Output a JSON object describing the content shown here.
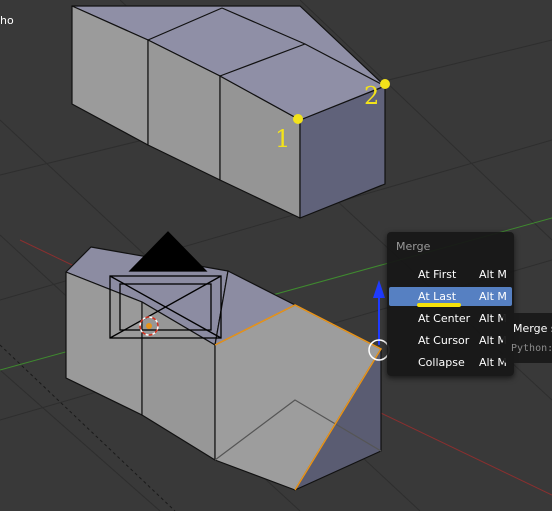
{
  "viewport": {
    "corner_text": "ho",
    "vertex_labels": [
      "1",
      "2"
    ]
  },
  "menu": {
    "title": "Merge",
    "items": [
      {
        "label": "At First",
        "shortcut": "Alt M",
        "active": false
      },
      {
        "label": "At Last",
        "shortcut": "Alt M",
        "active": true
      },
      {
        "label": "At Center",
        "shortcut": "Alt M",
        "active": false
      },
      {
        "label": "At Cursor",
        "shortcut": "Alt M",
        "active": false
      },
      {
        "label": "Collapse",
        "shortcut": "Alt M",
        "active": false
      }
    ]
  },
  "tooltip": {
    "title": "Merge s",
    "python": "Python:"
  },
  "colors": {
    "background": "#393939",
    "menu_highlight": "#5680c2",
    "annotation": "#f3e31a",
    "selection_edge": "#e8941a",
    "z_axis": "#1f3bff"
  }
}
